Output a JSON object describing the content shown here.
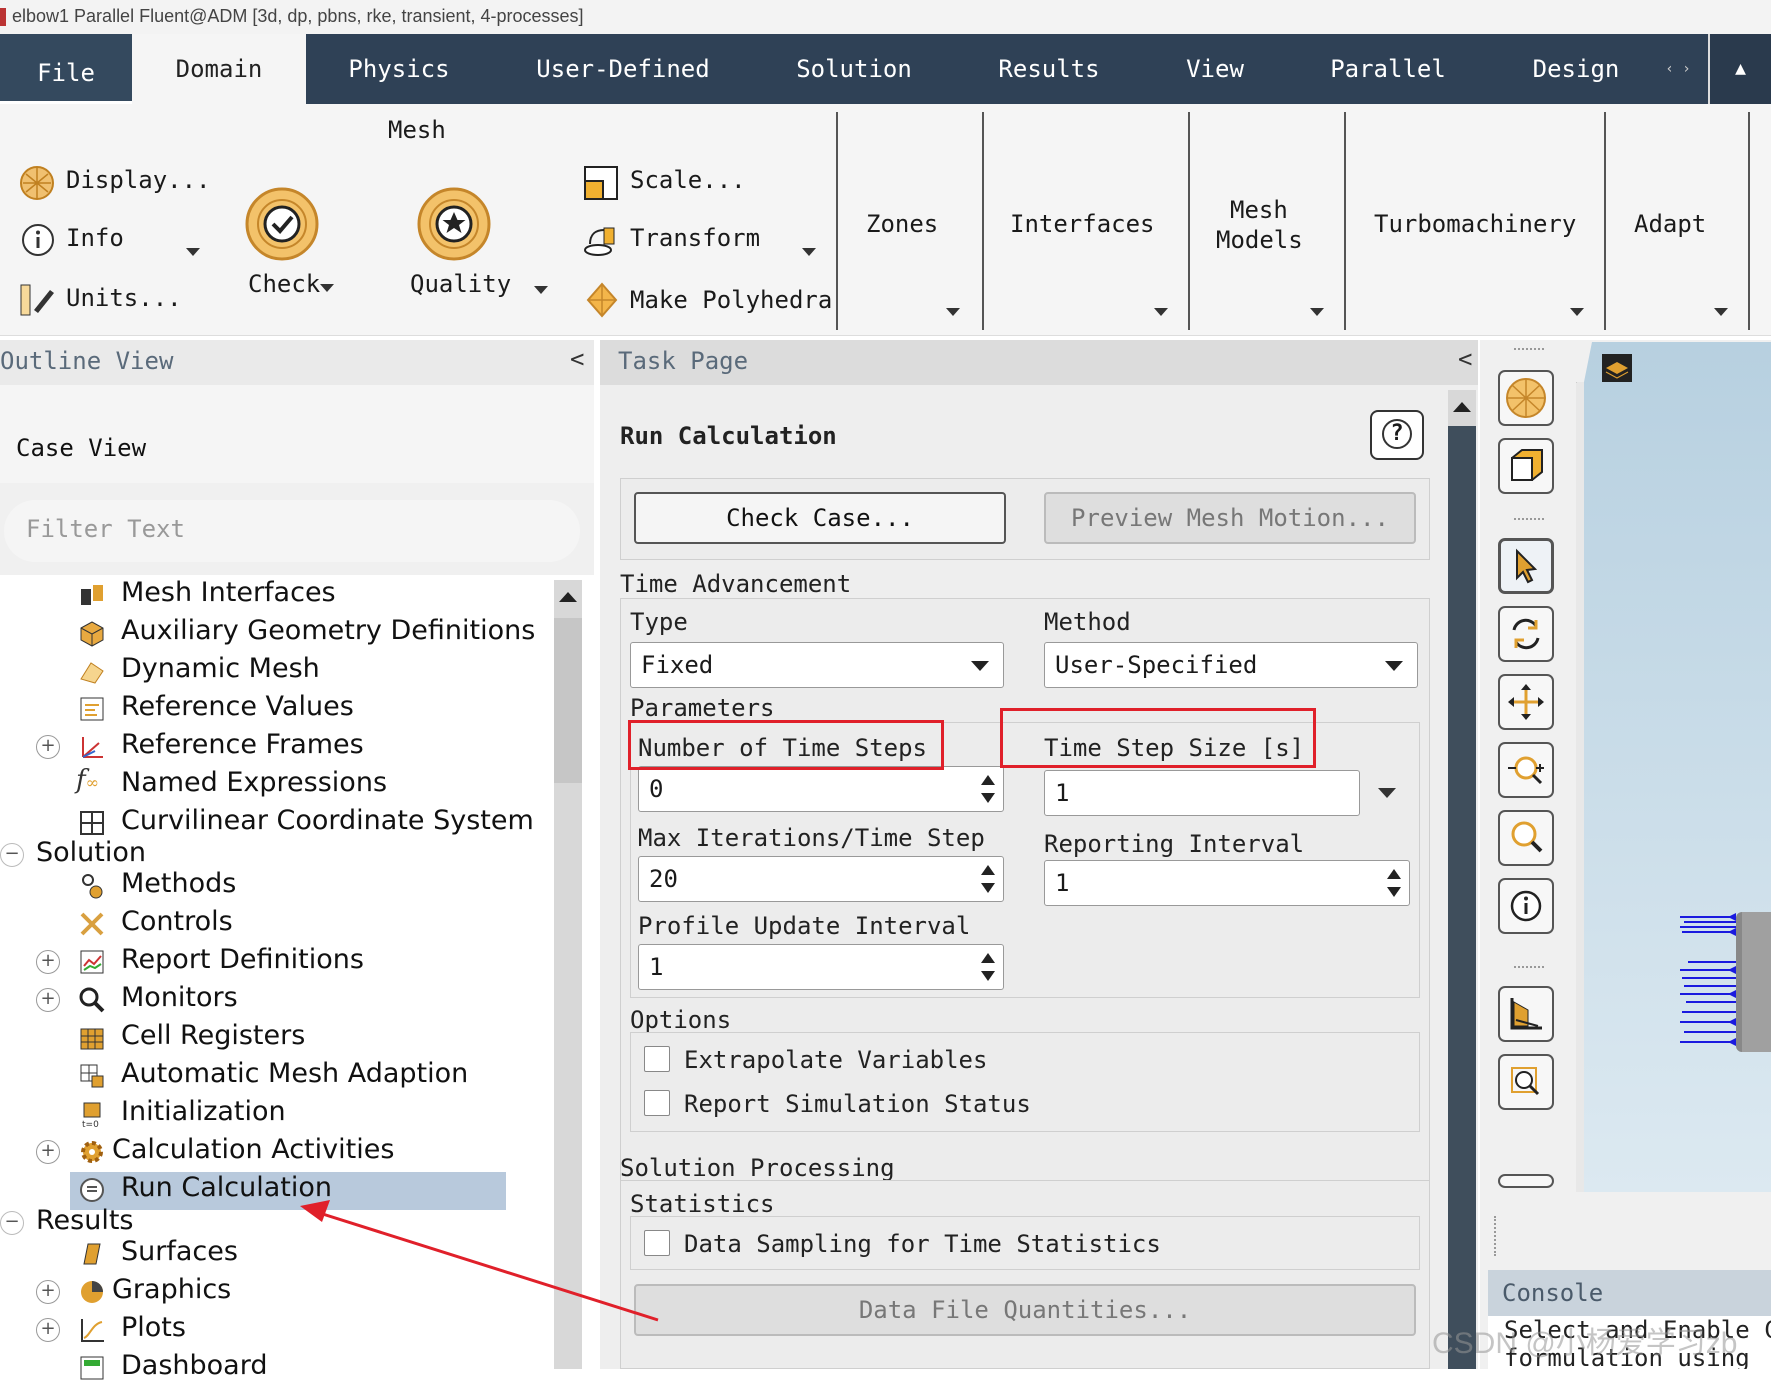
{
  "window": {
    "title": "elbow1 Parallel Fluent@ADM  [3d, dp, pbns, rke, transient, 4-processes]"
  },
  "menubar": {
    "tabs": [
      "File",
      "Domain",
      "Physics",
      "User-Defined",
      "Solution",
      "Results",
      "View",
      "Parallel",
      "Design"
    ],
    "active": "Domain",
    "scroll_arrows": "‹ ›",
    "collapse_glyph": "▲"
  },
  "ribbon": {
    "mesh_group": "Mesh",
    "display": "Display...",
    "info": "Info",
    "units": "Units...",
    "check": "Check",
    "quality": "Quality",
    "scale": "Scale...",
    "transform": "Transform",
    "make_polyhedra": "Make Polyhedra",
    "zones": "Zones",
    "interfaces": "Interfaces",
    "mesh_models_1": "Mesh",
    "mesh_models_2": "Models",
    "turbomachinery": "Turbomachinery",
    "adapt": "Adapt"
  },
  "outline": {
    "header": "Outline View",
    "collapse": "<",
    "case_view": "Case View",
    "filter_placeholder": "Filter Text",
    "items": [
      {
        "label": "Mesh Interfaces"
      },
      {
        "label": "Auxiliary Geometry Definitions"
      },
      {
        "label": "Dynamic Mesh"
      },
      {
        "label": "Reference Values"
      },
      {
        "label": "Reference Frames"
      },
      {
        "label": "Named Expressions"
      },
      {
        "label": "Curvilinear Coordinate System"
      },
      {
        "label": "Solution"
      },
      {
        "label": "Methods"
      },
      {
        "label": "Controls"
      },
      {
        "label": "Report Definitions"
      },
      {
        "label": "Monitors"
      },
      {
        "label": "Cell Registers"
      },
      {
        "label": "Automatic Mesh Adaption"
      },
      {
        "label": "Initialization"
      },
      {
        "label": "Calculation Activities"
      },
      {
        "label": "Run Calculation"
      },
      {
        "label": "Results"
      },
      {
        "label": "Surfaces"
      },
      {
        "label": "Graphics"
      },
      {
        "label": "Plots"
      },
      {
        "label": "Dashboard"
      }
    ]
  },
  "task": {
    "header": "Task Page",
    "collapse": "<",
    "title": "Run Calculation",
    "help": "?",
    "check_case": "Check Case...",
    "preview_mesh_motion": "Preview Mesh Motion...",
    "time_advancement": "Time Advancement",
    "type_label": "Type",
    "type_value": "Fixed",
    "method_label": "Method",
    "method_value": "User-Specified",
    "parameters": "Parameters",
    "num_time_steps_label": "Number of Time Steps",
    "num_time_steps_value": "0",
    "time_step_size_label": "Time Step Size [s]",
    "time_step_size_value": "1",
    "max_iter_label": "Max Iterations/Time Step",
    "max_iter_value": "20",
    "reporting_interval_label": "Reporting Interval",
    "reporting_interval_value": "1",
    "profile_update_label": "Profile Update Interval",
    "profile_update_value": "1",
    "options": "Options",
    "extrapolate": "Extrapolate Variables",
    "report_status": "Report Simulation Status",
    "solution_processing": "Solution Processing",
    "statistics": "Statistics",
    "data_sampling": "Data Sampling for Time Statistics",
    "data_file_quantities": "Data File Quantities..."
  },
  "console": {
    "header": "Console",
    "text": "Select and Enable Ch\nformulation using"
  },
  "watermark": "CSDN @小杨爱学习zb",
  "colors": {
    "menubar": "#2f4156",
    "highlight": "#b8c9dc",
    "annotation_red": "#e0202a"
  }
}
